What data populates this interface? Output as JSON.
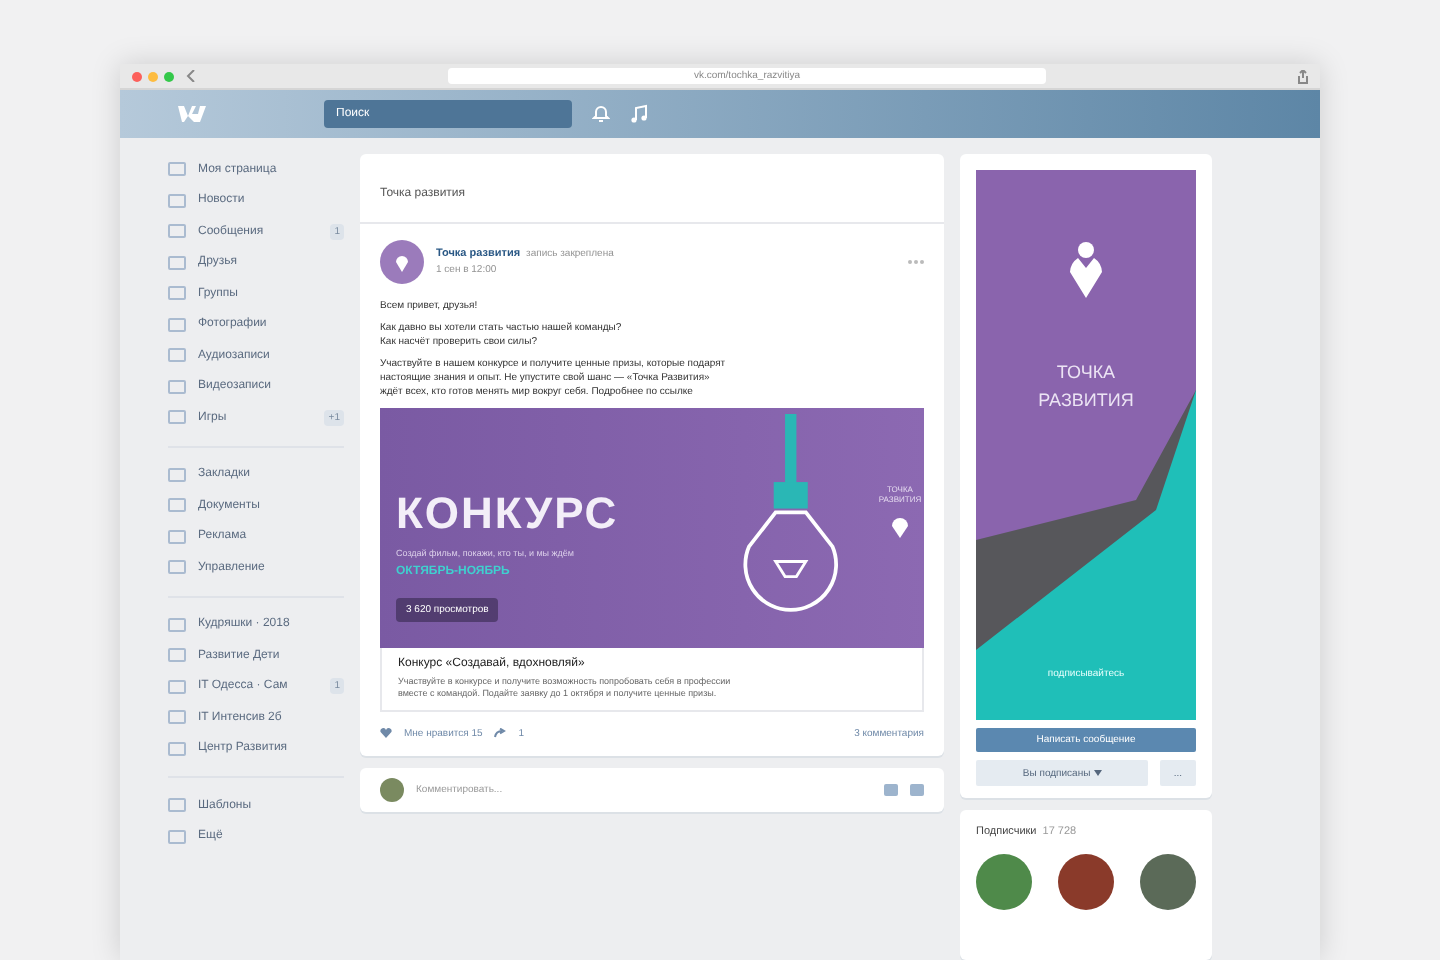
{
  "browser": {
    "url": "vk.com/tochka_razvitiya"
  },
  "header": {
    "search": {
      "placeholder": "Поиск"
    }
  },
  "menu": {
    "groups": [
      [
        {
          "label": "Моя страница"
        },
        {
          "label": "Новости"
        },
        {
          "label": "Сообщения",
          "badge": "1"
        },
        {
          "label": "Друзья"
        },
        {
          "label": "Группы"
        },
        {
          "label": "Фотографии"
        },
        {
          "label": "Аудиозаписи"
        },
        {
          "label": "Видеозаписи"
        },
        {
          "label": "Игры",
          "badge": "+1"
        }
      ],
      [
        {
          "label": "Закладки"
        },
        {
          "label": "Документы"
        },
        {
          "label": "Реклама"
        },
        {
          "label": "Управление"
        }
      ],
      [
        {
          "label": "Кудряшки · 2018"
        },
        {
          "label": "Развитие Дети"
        },
        {
          "label": "IT Одесса · Сам",
          "badge": "1"
        },
        {
          "label": "IT Интенсив 2б"
        },
        {
          "label": "Центр Развития"
        }
      ],
      [
        {
          "label": "Шаблоны"
        },
        {
          "label": "Ещё"
        }
      ]
    ]
  },
  "feed": {
    "tab": "Точка развития",
    "post": {
      "author": "Точка развития",
      "subtitle": "запись закреплена",
      "date": "1 сен в 12:00",
      "paragraphs": [
        "Всем привет, друзья!",
        "Как давно вы хотели стать частью нашей команды?\nКак насчёт проверить свои силы?",
        "Участвуйте в нашем конкурсе и получите ценные призы, которые подарят\nнастоящие знания и опыт. Не упустите свой шанс — «Точка Развития»\nждёт всех, кто готов менять мир вокруг себя. Подробнее по ссылке"
      ],
      "banner": {
        "title": "КОНКУРС",
        "subtitle": "Создай фильм, покажи, кто ты, и мы ждём",
        "dates": "ОКТЯБРЬ-НОЯБРЬ",
        "badge": "ТОЧКА РАЗВИТИЯ",
        "tag": "3 620 просмотров"
      },
      "link": {
        "title": "Конкурс «Создавай, вдохновляй»",
        "text": "Участвуйте в конкурсе и получите возможность попробовать себя в профессии\nвместе с командой. Подайте заявку до 1 октября и получите ценные призы."
      },
      "actions": {
        "like": "Мне нравится",
        "like_count": "15",
        "share": "1",
        "comments": "3 комментария"
      }
    },
    "comment": {
      "placeholder": "Комментировать..."
    }
  },
  "side": {
    "cover": {
      "title": "ТОЧКА РАЗВИТИЯ",
      "caption": "подписывайтесь"
    },
    "primary_button": "Написать сообщение",
    "secondary_button": "Вы подписаны",
    "more_button": "...",
    "members": {
      "title": "Подписчики",
      "count": "17 728"
    }
  }
}
